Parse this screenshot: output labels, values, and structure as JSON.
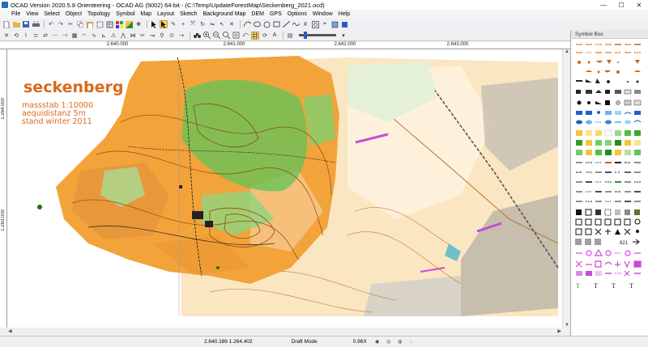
{
  "window": {
    "title": "OCAD Version 2020.5.8 Orienteering - OCAD AG (5002) 64-bit - (C:\\Temp\\UpdateForestMap\\Seckenberg_2021.ocd)",
    "minimize_glyph": "—",
    "maximize_glyph": "☐",
    "close_glyph": "✕"
  },
  "menu": [
    "File",
    "View",
    "Select",
    "Object",
    "Topology",
    "Symbol",
    "Map",
    "Layout",
    "Sketch",
    "Background Map",
    "DEM",
    "GPS",
    "Options",
    "Window",
    "Help"
  ],
  "ruler": {
    "x_labels": [
      "2.640.000",
      "2.641.000",
      "2.642.000",
      "2.643.000"
    ],
    "y_labels": [
      "1.264.000",
      "1.263.000"
    ]
  },
  "map_text": {
    "title": "seckenberg",
    "scale": "massstab 1:10000",
    "contour": "aequidistanz   5m",
    "status": "stand  winter 2011"
  },
  "symbol_box": {
    "title": "Symbol Box",
    "text_symbols": [
      "T",
      "T",
      "T",
      "T"
    ]
  },
  "statusbar": {
    "coordinates": "2.640.186   1.264.402",
    "mode": "Draft Mode",
    "zoom": "0.86X"
  },
  "colors": {
    "forest_orange": "#f2a33a",
    "open_land": "#fbd69a",
    "forest_green": "#5fc45a",
    "contour_brown": "#b0651e",
    "title_orange": "#d8691e",
    "purple": "#c84ad8"
  }
}
